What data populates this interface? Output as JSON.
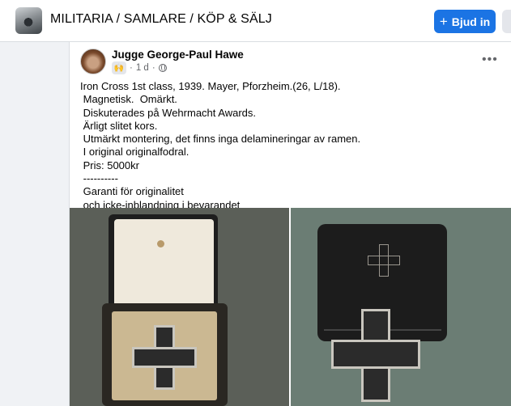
{
  "header": {
    "group_title": "MILITARIA / SAMLARE / KÖP & SÄLJ",
    "invite_label": "Bjud in",
    "invite_icon": "+"
  },
  "post": {
    "author": "Jugge George-Paul Hawe",
    "badge_icon": "🙌",
    "time": "1 d",
    "dot": "·",
    "menu_icon": "•••",
    "lines": [
      "Iron Cross 1st class, 1939. Mayer, Pforzheim.(26, L/18).",
      " Magnetisk.  Omärkt.",
      " Diskuterades på Wehrmacht Awards.",
      " Ärligt slitet kors.",
      " Utmärkt montering, det finns inga delamineringar av ramen.",
      " I original originalfodral.",
      " Pris: 5000kr",
      " ----------",
      " Garanti för originalitet",
      " och icke-inblandning i bevarandet"
    ]
  }
}
